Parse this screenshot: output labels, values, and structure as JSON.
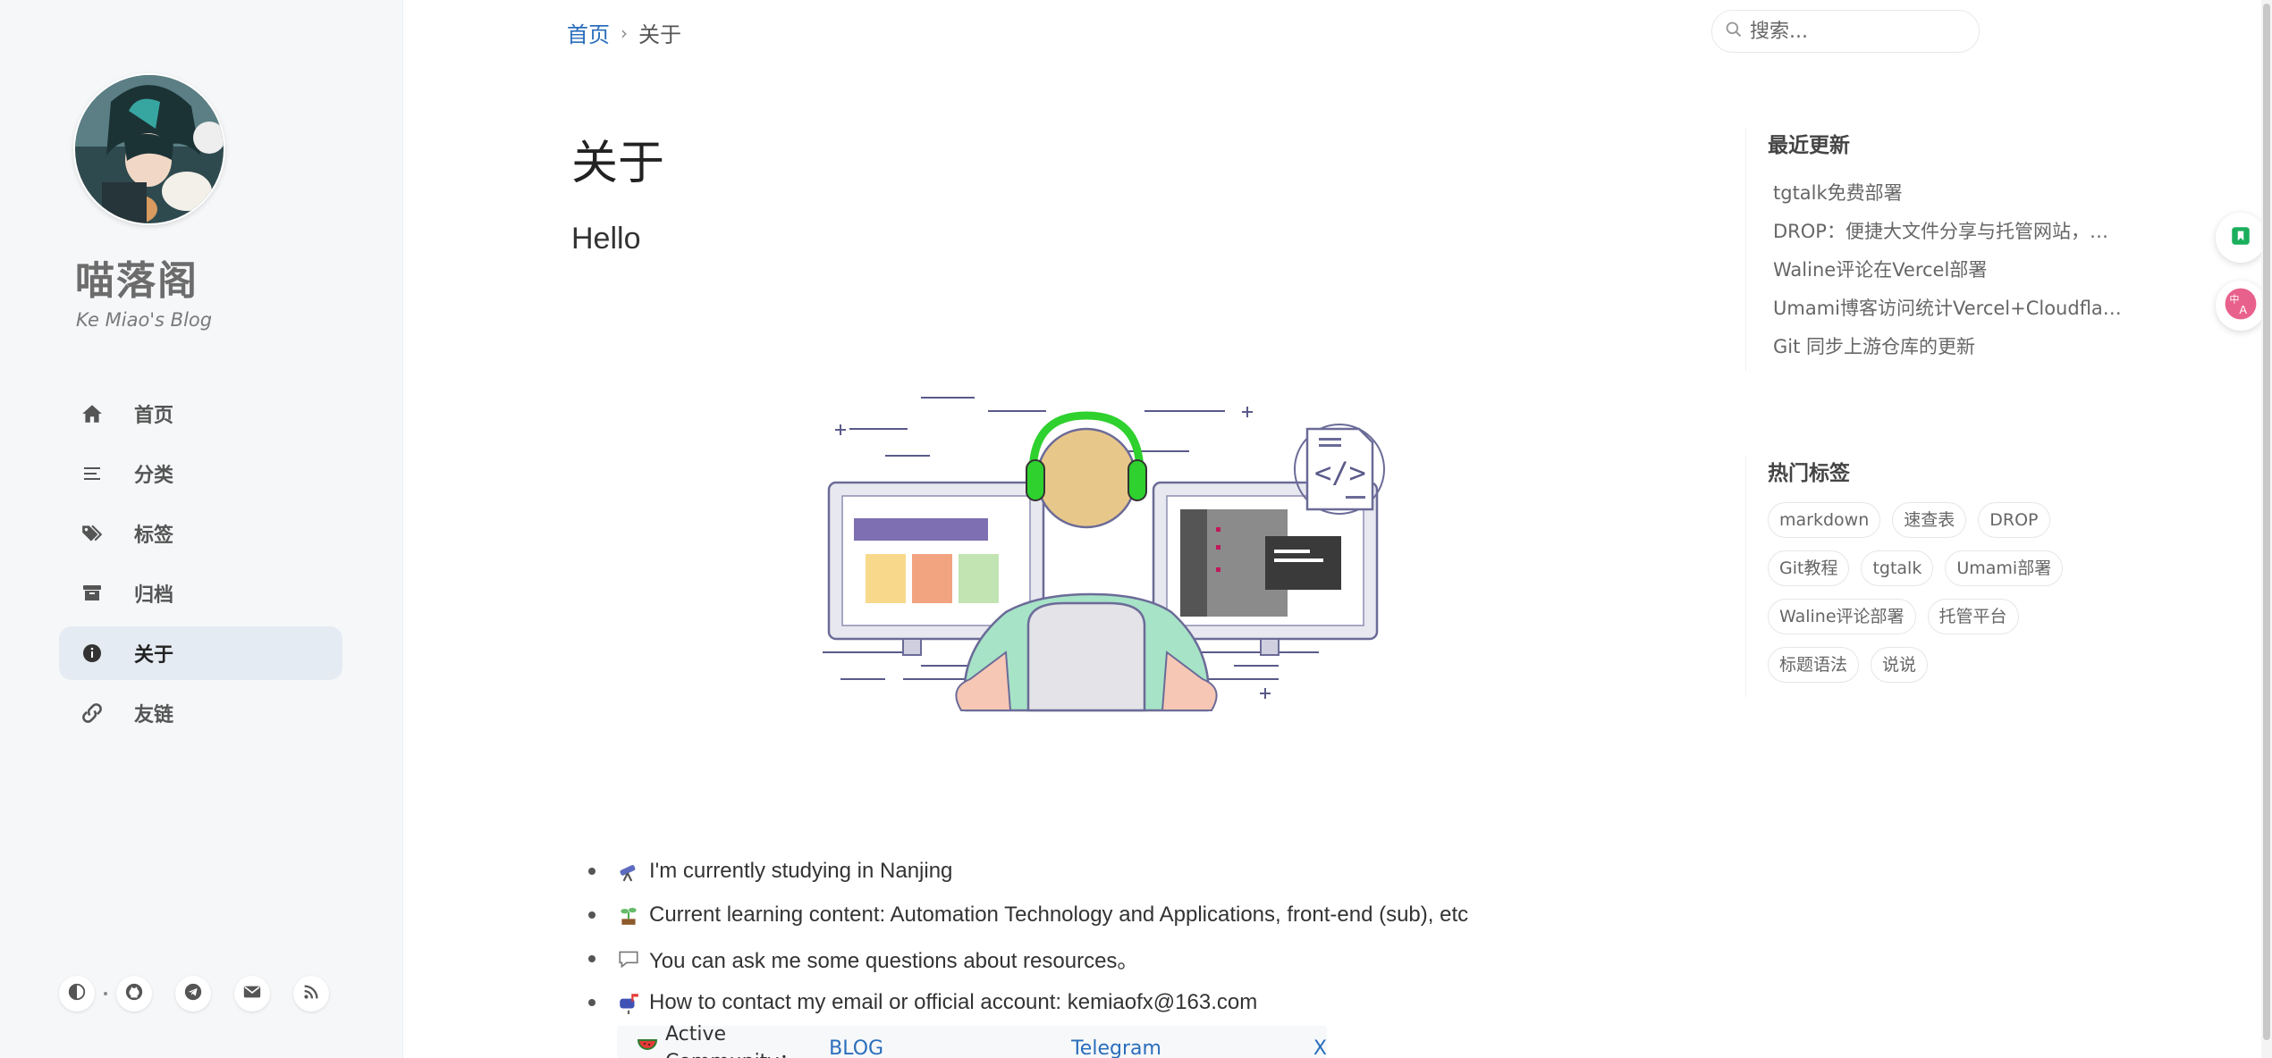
{
  "sidebar": {
    "site_title": "喵落阁",
    "site_subtitle": "Ke Miao's Blog",
    "nav": [
      {
        "label": "首页",
        "icon": "home-icon"
      },
      {
        "label": "分类",
        "icon": "list-icon"
      },
      {
        "label": "标签",
        "icon": "tags-icon"
      },
      {
        "label": "归档",
        "icon": "archive-icon"
      },
      {
        "label": "关于",
        "icon": "info-icon",
        "active": true
      },
      {
        "label": "友链",
        "icon": "link-icon"
      }
    ],
    "social_icons": [
      "theme-toggle-icon",
      "github-icon",
      "telegram-icon",
      "email-icon",
      "rss-icon"
    ]
  },
  "breadcrumb": {
    "home": "首页",
    "separator": "›",
    "current": "关于"
  },
  "search": {
    "placeholder": "搜索..."
  },
  "main": {
    "title": "关于",
    "hello": "Hello",
    "list": [
      {
        "emoji": "telescope-icon",
        "text": "I'm currently studying in Nanjing"
      },
      {
        "emoji": "seedling-icon",
        "text": "Current learning content: Automation Technology and Applications, front-end (sub), etc"
      },
      {
        "emoji": "speech-bubble-icon",
        "text": "You can ask me some questions about resources。"
      },
      {
        "emoji": "mailbox-icon",
        "text": "How to contact my email or official account: kemiaofx@163.com"
      }
    ],
    "community": {
      "label": "Active Community：",
      "links": [
        "BLOG",
        "Telegram",
        "X"
      ]
    }
  },
  "recent": {
    "title": "最近更新",
    "items": [
      "tgtalk免费部署",
      "DROP：便捷大文件分享与托管网站，…",
      "Waline评论在Vercel部署",
      "Umami博客访问统计Vercel+Cloudflare …",
      "Git 同步上游仓库的更新"
    ]
  },
  "tags": {
    "title": "热门标签",
    "items": [
      "markdown",
      "速查表",
      "DROP",
      "Git教程",
      "tgtalk",
      "Umami部署",
      "Waline评论部署",
      "托管平台",
      "标题语法",
      "说说"
    ]
  },
  "colors": {
    "accent": "#2a6ebb",
    "sidebar_bg": "#f5f7f9",
    "active_nav_bg": "#e5ebf2",
    "bookmark_green": "#1aaf5d",
    "translate_pink": "#e8618c"
  }
}
